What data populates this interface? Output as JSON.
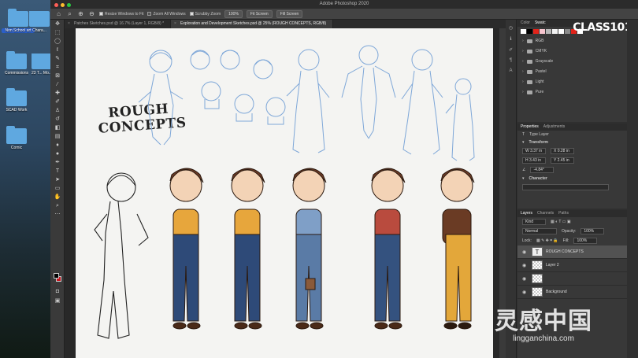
{
  "desktop": {
    "icons": [
      {
        "label": "Non School art",
        "selected": true
      },
      {
        "label": "Chara..."
      },
      {
        "label": "Commissions"
      },
      {
        "label": "23 T... Mo..."
      },
      {
        "label": "SCAD Work"
      },
      {
        "label": "Comic"
      }
    ],
    "right_labels": [
      "Scre",
      "19-12",
      "Scre",
      "019-0"
    ]
  },
  "app": {
    "title": "Adobe Photoshop 2020",
    "options": {
      "resize_windows": "Resize Windows to Fit",
      "zoom_all": "Zoom All Windows",
      "scrubby_zoom": "Scrubby Zoom",
      "zoom_value": "100%",
      "fit_screen": "Fit Screen",
      "fill_screen": "Fill Screen"
    },
    "tabs": [
      {
        "label": "Patches Sketches.psd @ 16.7% (Layer 1, RGB/8) *",
        "active": false
      },
      {
        "label": "Exploration and Development Sketches.psd @ 25% (ROUGH CONCEPTS, RGB/8)",
        "active": true
      }
    ]
  },
  "document": {
    "heading_line1": "ROUGH",
    "heading_line2": "CONCEPTS"
  },
  "panels": {
    "swatches": {
      "tabs": [
        "Color",
        "Swatc"
      ],
      "colors": [
        "#ffffff",
        "#000000",
        "#e2231a",
        "#f7c6cf",
        "#b8b8b8",
        "#f2f2f2",
        "#ffffff",
        "#8a8a8a",
        "#e2231a",
        "#ffffff"
      ],
      "groups": [
        "RGB",
        "CMYK",
        "Grayscale",
        "Pastel",
        "Light",
        "Pure"
      ]
    },
    "brand": "CLASS101",
    "properties": {
      "tabs": [
        "Properties",
        "Adjustments"
      ],
      "type": "Type Layer",
      "transform_label": "Transform",
      "w": "W  3.37 in",
      "h": "H  3.43 in",
      "x": "X  0.28 in",
      "y": "Y  2.45 in",
      "angle": "-4.84°",
      "character_label": "Character"
    },
    "layers": {
      "tabs": [
        "Layers",
        "Channels",
        "Paths"
      ],
      "kind": "Kind",
      "mode": "Normal",
      "opacity_label": "Opacity:",
      "opacity": "100%",
      "lock_label": "Lock:",
      "fill_label": "Fill:",
      "fill": "100%",
      "items": [
        {
          "name": "ROUGH CONCEPTS",
          "thumb": "T",
          "selected": true
        },
        {
          "name": "Layer 2",
          "thumb": "",
          "selected": false
        },
        {
          "name": "",
          "thumb": "",
          "selected": false
        },
        {
          "name": "Background",
          "thumb": "",
          "selected": false
        }
      ]
    }
  },
  "watermark": {
    "cn": "灵感中国",
    "url": "lingganchina.com"
  }
}
